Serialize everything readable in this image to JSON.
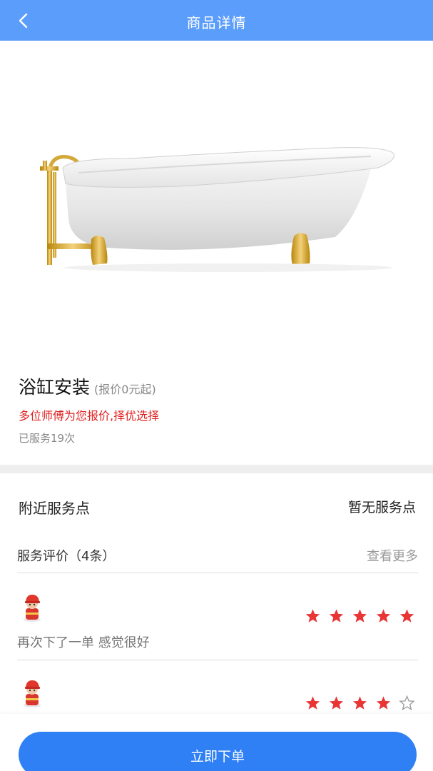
{
  "header": {
    "title": "商品详情",
    "back_icon": "chevron-left-icon"
  },
  "product": {
    "image": "bathtub-photo",
    "name": "浴缸安装",
    "price_note": "(报价0元起)",
    "promo": "多位师傅为您报价,择优选择",
    "served": "已服务19次"
  },
  "nearby": {
    "label": "附近服务点",
    "value": "暂无服务点"
  },
  "reviews": {
    "title": "服务评价（4条）",
    "more": "查看更多",
    "items": [
      {
        "avatar": "worker-avatar-icon",
        "rating": 5,
        "max_rating": 5,
        "text": "再次下了一单 感觉很好"
      },
      {
        "avatar": "worker-avatar-icon",
        "rating": 4,
        "max_rating": 5,
        "text": ""
      }
    ]
  },
  "footer": {
    "order_label": "立即下单"
  },
  "colors": {
    "header": "#5b9dfa",
    "primary_button": "#2f7ff5",
    "promo_text": "#e02020",
    "star_filled": "#e83535",
    "star_empty": "#9a9a9a"
  }
}
